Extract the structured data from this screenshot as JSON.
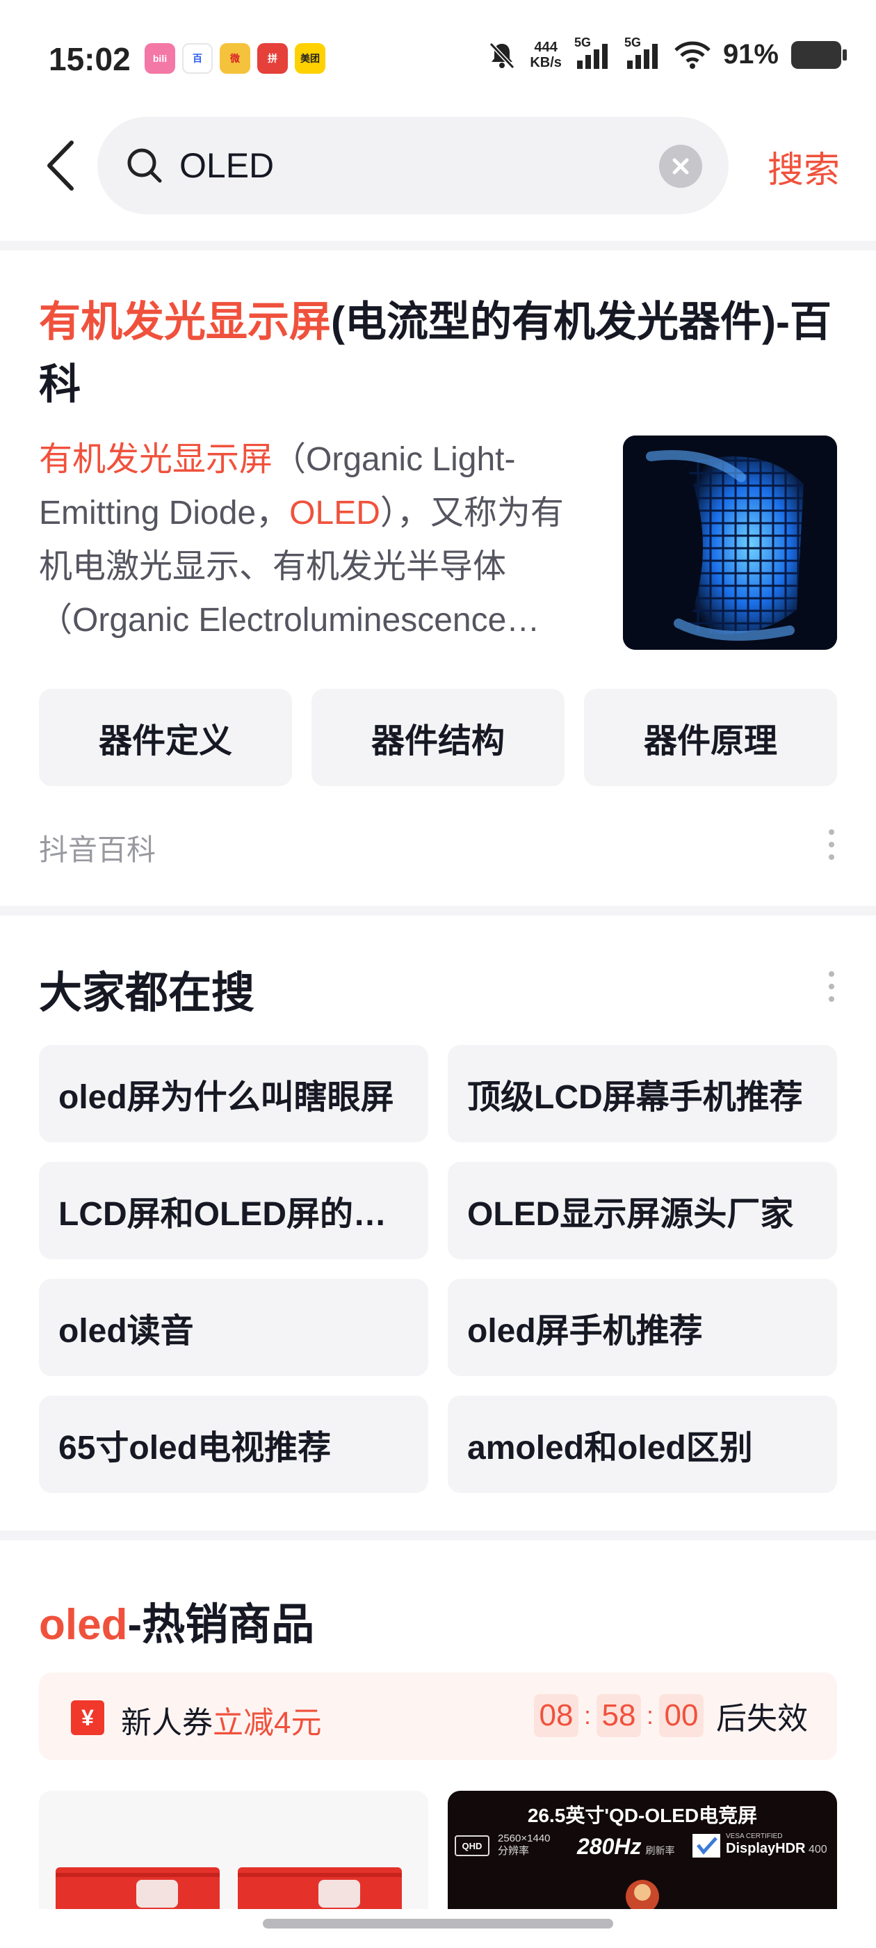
{
  "status_bar": {
    "time": "15:02",
    "apps": [
      {
        "name": "bilibili",
        "label": "bili",
        "color": "#f478a5"
      },
      {
        "name": "baidu",
        "label": "百",
        "color": "#ffffff"
      },
      {
        "name": "weibo",
        "label": "微",
        "color": "#f5c33b"
      },
      {
        "name": "pinduoduo",
        "label": "拼",
        "color": "#e5403a"
      },
      {
        "name": "meituan",
        "label": "美团",
        "color": "#ffd100"
      }
    ],
    "net_speed": "444",
    "net_unit": "KB/s",
    "signal_1": "5G",
    "signal_2": "5G",
    "battery": "91%"
  },
  "search": {
    "query": "OLED",
    "submit_label": "搜索"
  },
  "baike": {
    "title_highlight": "有机发光显示屏",
    "title_rest": "(电流型的有机发光器件)-百科",
    "desc_highlight_1": "有机发光显示屏",
    "desc_part_1": "（Organic Light-Emitting Diode，",
    "desc_highlight_2": "OLED",
    "desc_part_2": "），又称为有机电激光显示、有机发光半导体（Organic Electroluminescence…",
    "tabs": [
      "器件定义",
      "器件结构",
      "器件原理"
    ],
    "source": "抖音百科"
  },
  "hot_search": {
    "title": "大家都在搜",
    "items": [
      "oled屏为什么叫瞎眼屏",
      "顶级LCD屏幕手机推荐",
      "LCD屏和OLED屏的…",
      "OLED显示屏源头厂家",
      "oled读音",
      "oled屏手机推荐",
      "65寸oled电视推荐",
      "amoled和oled区别"
    ]
  },
  "goods": {
    "title_highlight": "oled",
    "title_rest": "-热销商品",
    "coupon_prefix": "新人券",
    "coupon_highlight": "立减4元",
    "coupon_icon": "¥",
    "countdown": [
      "08",
      "58",
      "00"
    ],
    "countdown_suffix": "后失效",
    "product_2_banner": "26.5英寸'QD-OLED电竞屏",
    "product_2_resolution": "2560×1440",
    "product_2_resolution_label": "分辨率",
    "product_2_refresh": "280Hz",
    "product_2_refresh_label": "刷新率",
    "product_2_badge": "DisplayHDR",
    "product_2_badge_level": "400",
    "product_2_badge_top": "VESA CERTIFIED",
    "product_2_qhd": "QHD"
  }
}
